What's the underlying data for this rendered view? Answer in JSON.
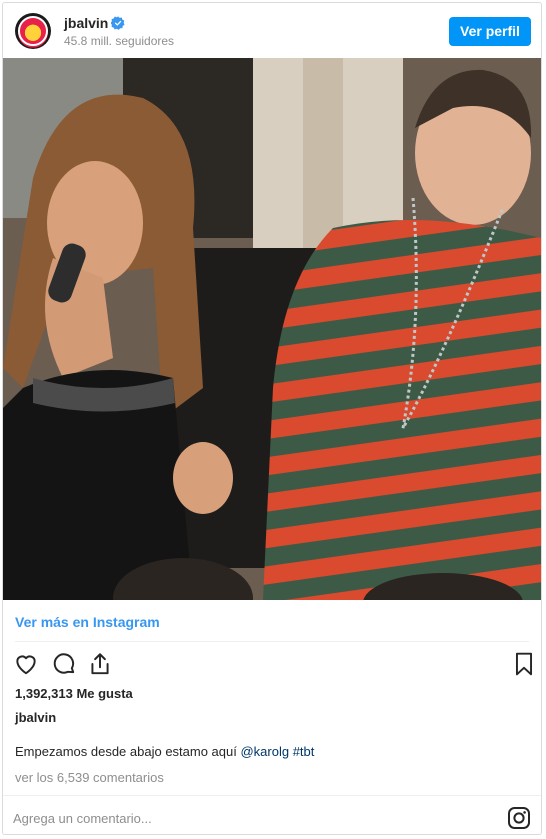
{
  "header": {
    "username": "jbalvin",
    "followers": "45.8 mill. seguidores",
    "profile_button": "Ver perfil",
    "avatar_icon": "salud-mental-logo-icon",
    "verified_icon": "verified-badge-icon"
  },
  "post": {
    "view_more": "Ver más en Instagram",
    "likes": "1,392,313 Me gusta",
    "caption_user": "jbalvin",
    "caption_text": "Empezamos desde abajo estamo aquí ",
    "caption_mention": "@karolg",
    "caption_hashtag": "#tbt",
    "comments_link": "ver los 6,539 comentarios"
  },
  "actions": {
    "like_icon": "heart-icon",
    "comment_icon": "comment-bubble-icon",
    "share_icon": "share-icon",
    "save_icon": "bookmark-icon"
  },
  "comment_box": {
    "placeholder": "Agrega un comentario...",
    "brand_icon": "instagram-icon"
  },
  "colors": {
    "accent": "#0095f6",
    "link": "#3897f0",
    "tag": "#003569",
    "muted": "#8e8e8e"
  }
}
